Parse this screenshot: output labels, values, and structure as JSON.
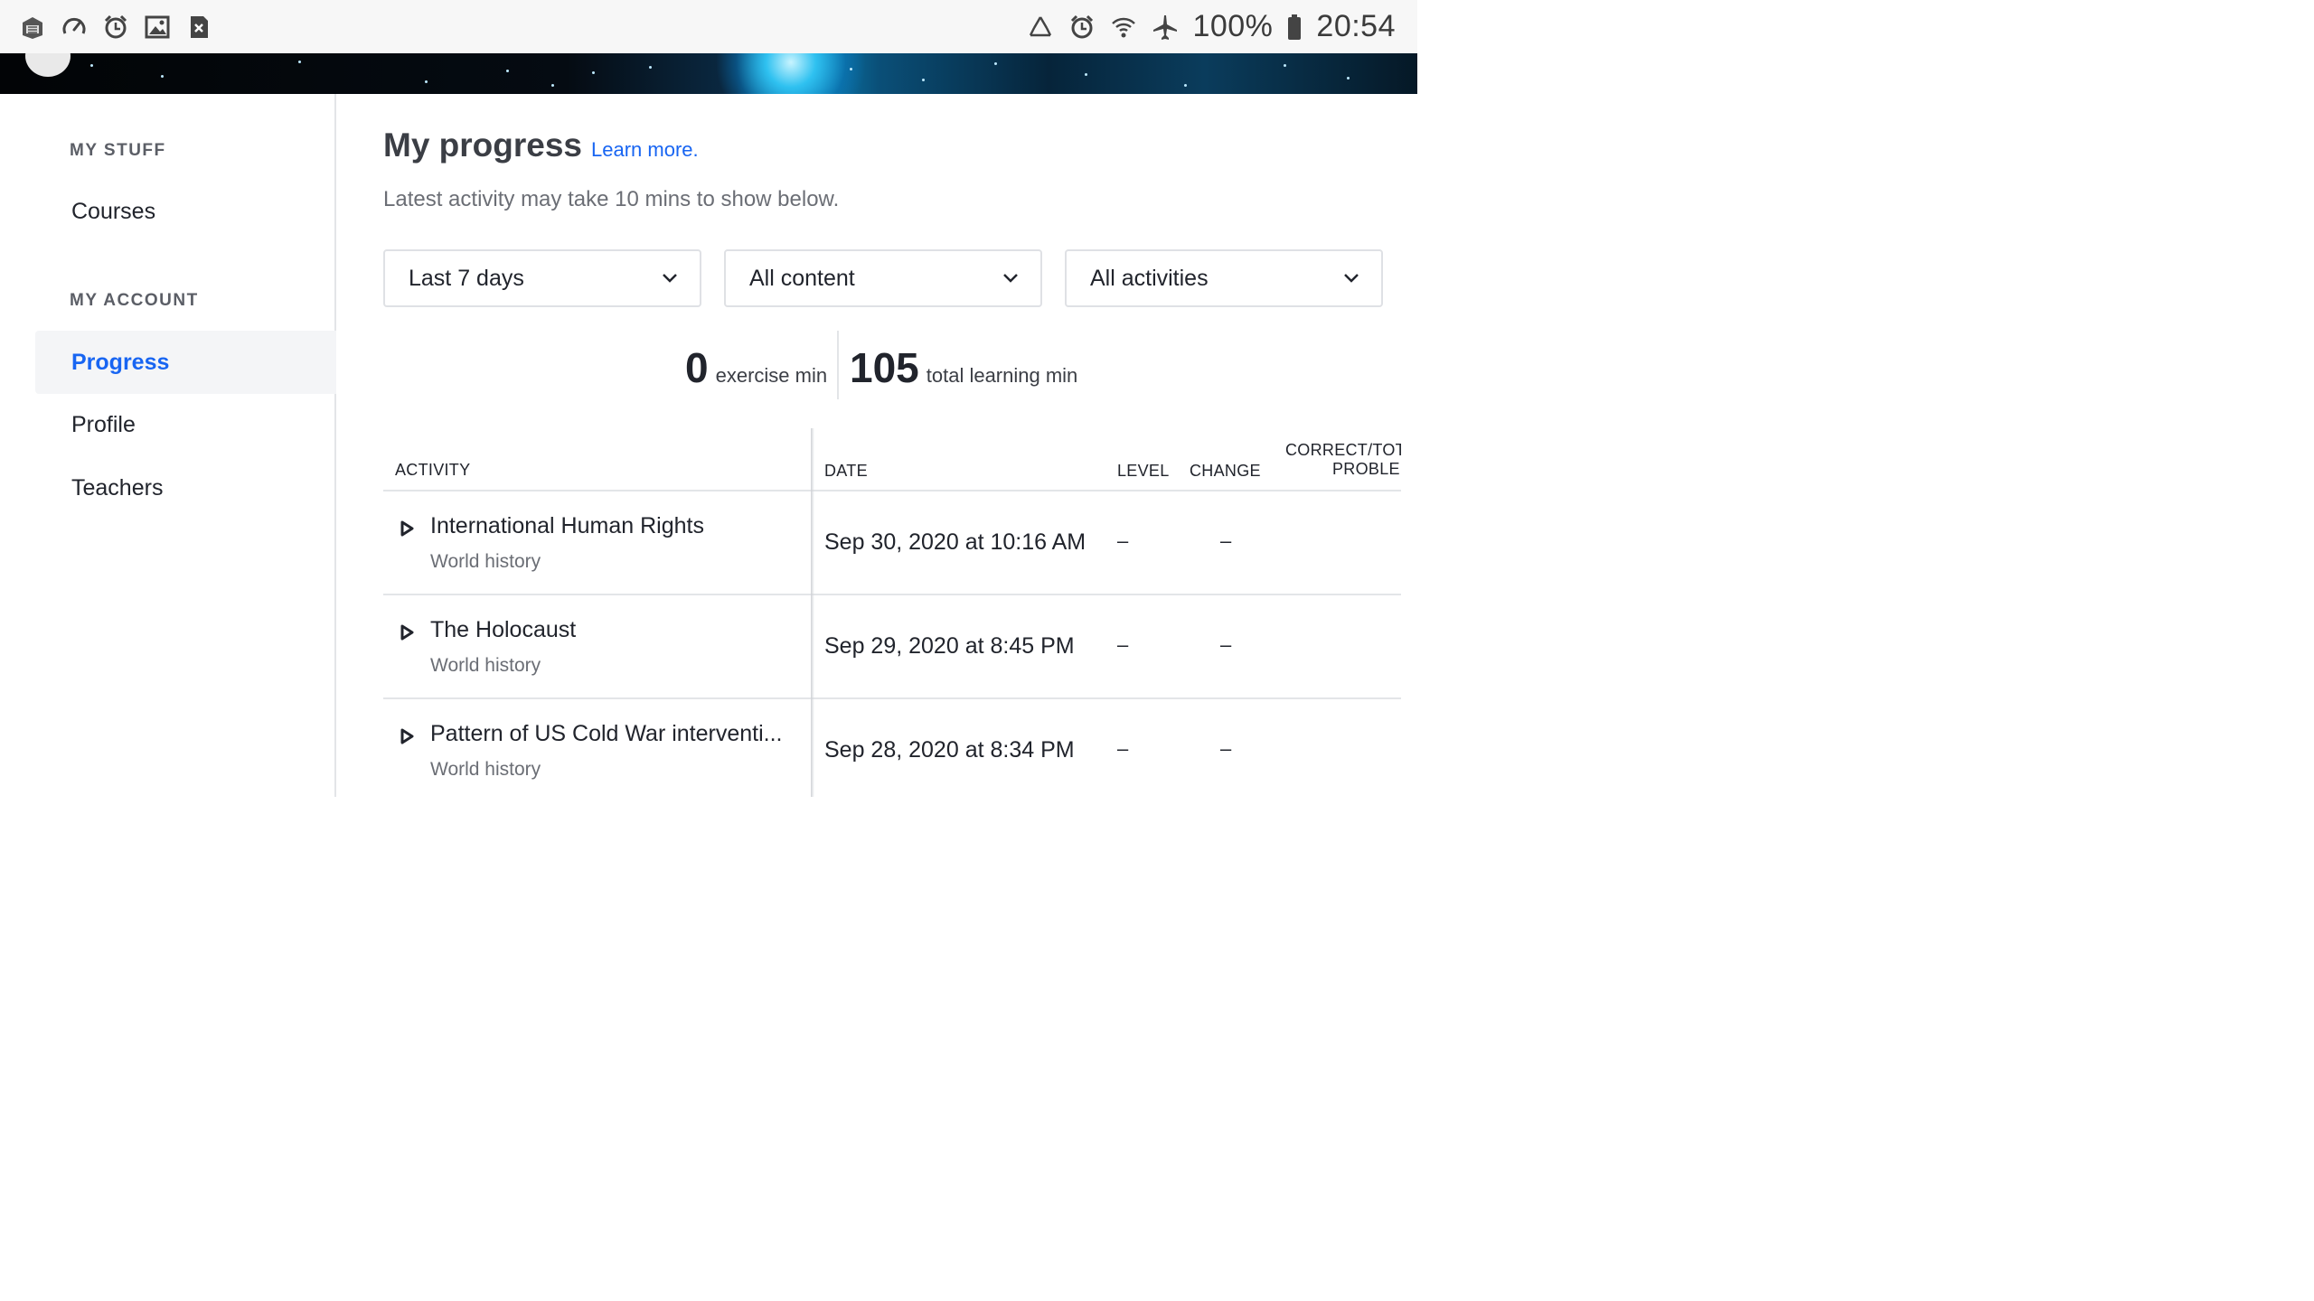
{
  "statusbar": {
    "left_icons": [
      "app-icon",
      "speedometer-icon",
      "alarm-icon",
      "image-icon",
      "close-box-icon"
    ],
    "right_icons": [
      "recycle-icon",
      "alarm-icon",
      "wifi-icon",
      "airplane-icon"
    ],
    "battery": "100%",
    "time": "20:54"
  },
  "sidebar": {
    "my_stuff_heading": "MY STUFF",
    "courses": "Courses",
    "my_account_heading": "MY ACCOUNT",
    "progress": "Progress",
    "profile": "Profile",
    "teachers": "Teachers"
  },
  "main": {
    "title": "My progress",
    "learn_more": "Learn more.",
    "subtitle": "Latest activity may take 10 mins to show below.",
    "filters": {
      "time": "Last 7 days",
      "content": "All content",
      "activity": "All activities"
    },
    "stats": {
      "exercise_value": "0",
      "exercise_label": "exercise min",
      "total_value": "105",
      "total_label": "total learning min"
    },
    "table": {
      "headers": {
        "activity": "ACTIVITY",
        "date": "DATE",
        "level": "LEVEL",
        "change": "CHANGE",
        "correct_line1": "CORRECT/TOT",
        "correct_line2": "PROBLE"
      },
      "rows": [
        {
          "title": "International Human Rights",
          "subject": "World history",
          "date": "Sep 30, 2020 at 10:16 AM",
          "level": "–",
          "change": "–"
        },
        {
          "title": "The Holocaust",
          "subject": "World history",
          "date": "Sep 29, 2020 at 8:45 PM",
          "level": "–",
          "change": "–"
        },
        {
          "title": "Pattern of US Cold War interventi...",
          "subject": "World history",
          "date": "Sep 28, 2020 at 8:34 PM",
          "level": "–",
          "change": "–"
        }
      ]
    }
  },
  "colors": {
    "accent": "#1865f2",
    "text": "#21242c",
    "muted": "#6b6e75"
  }
}
